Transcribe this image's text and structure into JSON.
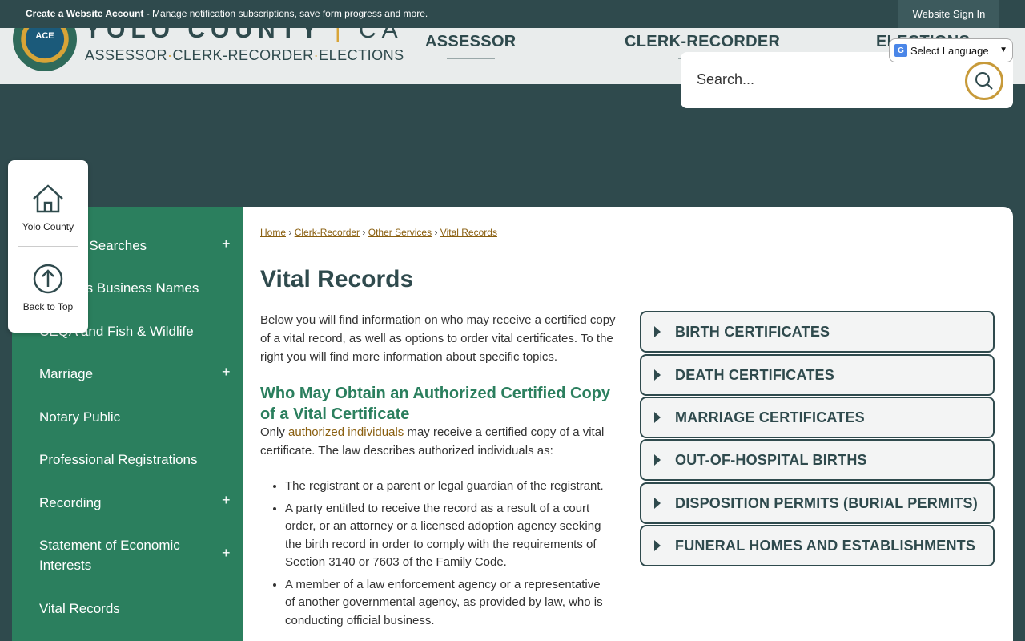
{
  "topbar": {
    "create_account": "Create a Website Account",
    "message": " - Manage notification subscriptions, save form progress and more.",
    "signin": "Website Sign In"
  },
  "header": {
    "seal_text": "ACE",
    "brand_name": "YOLO COUNTY",
    "brand_ca": "CA",
    "brand_sub": [
      "ASSESSOR",
      "CLERK-RECORDER",
      "ELECTIONS"
    ],
    "nav": [
      "ASSESSOR",
      "CLERK-RECORDER",
      "ELECTIONS"
    ]
  },
  "language": {
    "label": "Select Language"
  },
  "search": {
    "placeholder": "Search..."
  },
  "quicklinks": {
    "home": "Yolo County",
    "top": "Back to Top"
  },
  "sidebar": {
    "items": [
      {
        "label": "Maps & Searches",
        "expandable": true
      },
      {
        "label": "Fictitious Business Names",
        "expandable": false
      },
      {
        "label": "CEQA and Fish & Wildlife",
        "expandable": false
      },
      {
        "label": "Marriage",
        "expandable": true
      },
      {
        "label": "Notary Public",
        "expandable": false
      },
      {
        "label": "Professional Registrations",
        "expandable": false
      },
      {
        "label": "Recording",
        "expandable": true
      },
      {
        "label": "Statement of Economic Interests",
        "expandable": true
      },
      {
        "label": "Vital Records",
        "expandable": false
      }
    ]
  },
  "breadcrumb": [
    "Home",
    "Clerk-Recorder",
    "Other Services",
    "Vital Records"
  ],
  "breadcrumb_sep": "›",
  "page": {
    "title": "Vital Records",
    "intro": "Below you will find information on who may receive a certified copy of a vital record, as well as options to order vital certificates. To the right you will find more information about specific topics.",
    "section_title": "Who May Obtain an Authorized Certified Copy of a Vital Certificate",
    "section_text_pre": "Only ",
    "section_link": "authorized individuals",
    "section_text_post": " may receive a certified copy of a vital certificate. The law describes authorized individuals as:",
    "list": [
      "The registrant or a parent or legal guardian of the registrant.",
      "A party entitled to receive the record as a result of a court order, or an attorney or a licensed adoption agency seeking the birth record in order to comply with the requirements of Section 3140 or 7603 of the Family Code.",
      "A member of a law enforcement agency or a representative of another governmental agency, as provided by law, who is conducting official business."
    ]
  },
  "accordion": [
    "BIRTH CERTIFICATES",
    "DEATH CERTIFICATES",
    "MARRIAGE CERTIFICATES",
    "OUT-OF-HOSPITAL BIRTHS",
    "DISPOSITION PERMITS (BURIAL PERMITS)",
    "FUNERAL HOMES AND ESTABLISHMENTS"
  ]
}
